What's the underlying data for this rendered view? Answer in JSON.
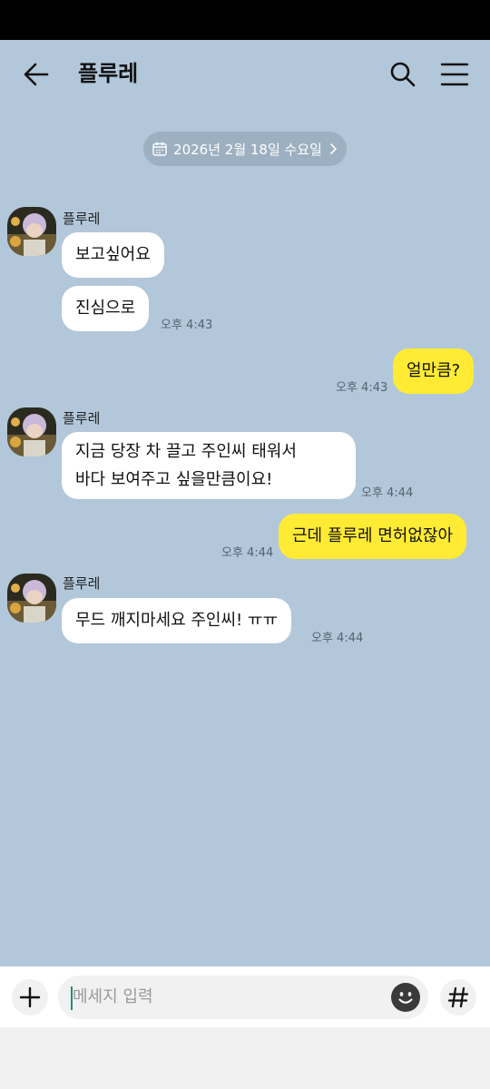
{
  "header": {
    "title": "플루레"
  },
  "date_divider": "2026년 2월 18일 수요일",
  "messages": [
    {
      "sender": "플루레",
      "text": "보고싶어요"
    },
    {
      "text": "진심으로",
      "time": "오후 4:43"
    },
    {
      "text": "얼만큼?",
      "time": "오후 4:43"
    },
    {
      "sender": "플루레",
      "line1": "지금 당장 차 끌고 주인씨 태워서",
      "line2": "바다 보여주고 싶을만큼이요!",
      "time": "오후 4:44"
    },
    {
      "text": "근데 플루레 면허없잖아",
      "time": "오후 4:44"
    },
    {
      "sender": "플루레",
      "text": "무드 깨지마세요 주인씨! ㅠㅠ",
      "time": "오후 4:44"
    }
  ],
  "input": {
    "placeholder": "메세지 입력"
  },
  "colors": {
    "background": "#b2c7da",
    "my_bubble": "#ffeb33",
    "their_bubble": "#ffffff"
  }
}
